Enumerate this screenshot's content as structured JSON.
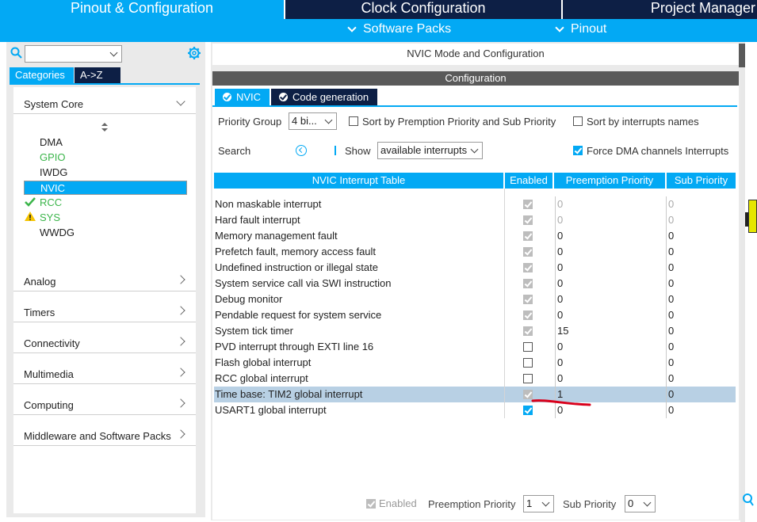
{
  "top_tabs": [
    "Pinout & Configuration",
    "Clock Configuration",
    "Project Manager"
  ],
  "sub_tabs": [
    "Software Packs",
    "Pinout"
  ],
  "left": {
    "search_value": "",
    "categories_tab": "Categories",
    "az_tab": "A->Z",
    "groups": [
      "System Core",
      "Analog",
      "Timers",
      "Connectivity",
      "Multimedia",
      "Computing",
      "Middleware and Software Packs"
    ],
    "system_core_items": [
      {
        "label": "DMA",
        "state": "normal"
      },
      {
        "label": "GPIO",
        "state": "green"
      },
      {
        "label": "IWDG",
        "state": "normal"
      },
      {
        "label": "NVIC",
        "state": "selected"
      },
      {
        "label": "RCC",
        "state": "ok"
      },
      {
        "label": "SYS",
        "state": "warning"
      },
      {
        "label": "WWDG",
        "state": "normal"
      }
    ],
    "icons": {
      "search": "search-icon",
      "settings": "gear-icon",
      "ok": "check-icon",
      "warning": "warning-icon"
    }
  },
  "right": {
    "mode_header": "NVIC Mode and Configuration",
    "config_header": "Configuration",
    "tabs": [
      "NVIC",
      "Code generation"
    ],
    "priority_group_label": "Priority Group",
    "priority_group_value": "4 bi...",
    "sort_premption_label": "Sort by Premption Priority and Sub Priority",
    "sort_names_label": "Sort by interrupts names",
    "search_label": "Search",
    "show_label": "Show",
    "show_value": "available interrupts",
    "force_dma_label": "Force DMA channels Interrupts",
    "table": {
      "headers": [
        "NVIC Interrupt Table",
        "Enabled",
        "Preemption Priority",
        "Sub Priority"
      ],
      "rows": [
        {
          "name": "Non maskable interrupt",
          "enabled": "grey",
          "prio": "0",
          "sub": "0",
          "dim": true
        },
        {
          "name": "Hard fault interrupt",
          "enabled": "grey",
          "prio": "0",
          "sub": "0",
          "dim": true
        },
        {
          "name": "Memory management fault",
          "enabled": "grey",
          "prio": "0",
          "sub": "0",
          "dim": false
        },
        {
          "name": "Prefetch fault, memory access fault",
          "enabled": "grey",
          "prio": "0",
          "sub": "0",
          "dim": false
        },
        {
          "name": "Undefined instruction or illegal state",
          "enabled": "grey",
          "prio": "0",
          "sub": "0",
          "dim": false
        },
        {
          "name": "System service call via SWI instruction",
          "enabled": "grey",
          "prio": "0",
          "sub": "0",
          "dim": false
        },
        {
          "name": "Debug monitor",
          "enabled": "grey",
          "prio": "0",
          "sub": "0",
          "dim": false
        },
        {
          "name": "Pendable request for system service",
          "enabled": "grey",
          "prio": "0",
          "sub": "0",
          "dim": false
        },
        {
          "name": "System tick timer",
          "enabled": "grey",
          "prio": "15",
          "sub": "0",
          "dim": false
        },
        {
          "name": "PVD interrupt through EXTI line 16",
          "enabled": "off",
          "prio": "0",
          "sub": "0",
          "dim": false
        },
        {
          "name": "Flash global interrupt",
          "enabled": "off",
          "prio": "0",
          "sub": "0",
          "dim": false
        },
        {
          "name": "RCC global interrupt",
          "enabled": "off",
          "prio": "0",
          "sub": "0",
          "dim": false
        },
        {
          "name": "Time base: TIM2 global interrupt",
          "enabled": "grey",
          "prio": "1",
          "sub": "0",
          "dim": false,
          "highlight": true
        },
        {
          "name": "USART1 global interrupt",
          "enabled": "on",
          "prio": "0",
          "sub": "0",
          "dim": false
        }
      ]
    },
    "bottom": {
      "enabled_label": "Enabled",
      "preemption_label": "Preemption Priority",
      "preemption_value": "1",
      "sub_label": "Sub Priority",
      "sub_value": "0"
    }
  },
  "colors": {
    "accent": "#03a9f4",
    "navy": "#0d1f45",
    "highlight": "#b8d0e4",
    "annotation": "#d9001b"
  }
}
